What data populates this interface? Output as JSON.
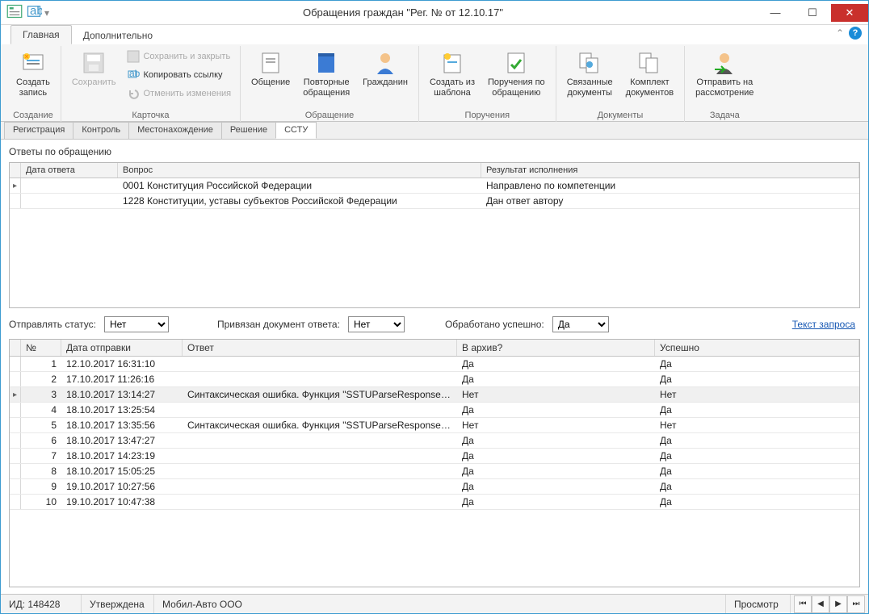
{
  "window": {
    "title": "Обращения граждан \"Рег. № от 12.10.17\""
  },
  "ribbon_tabs": {
    "main": "Главная",
    "extra": "Дополнительно"
  },
  "ribbon": {
    "create": {
      "btn": "Создать\nзапись",
      "group": "Создание"
    },
    "card": {
      "save": "Сохранить",
      "save_close": "Сохранить и закрыть",
      "copy_link": "Копировать ссылку",
      "undo": "Отменить изменения",
      "group": "Карточка"
    },
    "request": {
      "general": "Общение",
      "repeat": "Повторные\nобращения",
      "citizen": "Гражданин",
      "group": "Обращение"
    },
    "orders": {
      "from_tpl": "Создать из\nшаблона",
      "by_req": "Поручения по\nобращению",
      "group": "Поручения"
    },
    "docs": {
      "linked": "Связанные\nдокументы",
      "set": "Комплект\nдокументов",
      "group": "Документы"
    },
    "task": {
      "send": "Отправить на\nрассмотрение",
      "group": "Задача"
    }
  },
  "doc_tabs": [
    "Регистрация",
    "Контроль",
    "Местонахождение",
    "Решение",
    "ССТУ"
  ],
  "answers": {
    "title": "Ответы по обращению",
    "headers": {
      "date": "Дата ответа",
      "question": "Вопрос",
      "result": "Результат исполнения"
    },
    "rows": [
      {
        "date": "",
        "question": "0001 Конституция Российской Федерации",
        "result": "Направлено по компетенции"
      },
      {
        "date": "",
        "question": "1228 Конституции, уставы субъектов Российской Федерации",
        "result": "Дан ответ автору"
      }
    ]
  },
  "filters": {
    "send_status_label": "Отправлять статус:",
    "send_status_value": "Нет",
    "doc_bound_label": "Привязан документ ответа:",
    "doc_bound_value": "Нет",
    "processed_label": "Обработано успешно:",
    "processed_value": "Да",
    "query_link": "Текст запроса"
  },
  "log": {
    "headers": {
      "num": "№",
      "sent": "Дата отправки",
      "answer": "Ответ",
      "archive": "В архив?",
      "success": "Успешно"
    },
    "rows": [
      {
        "n": "1",
        "sent": "12.10.2017 16:31:10",
        "answer": "",
        "archive": "Да",
        "success": "Да"
      },
      {
        "n": "2",
        "sent": "17.10.2017 11:26:16",
        "answer": "",
        "archive": "Да",
        "success": "Да"
      },
      {
        "n": "3",
        "sent": "18.10.2017 13:14:27",
        "answer": "Синтаксическая ошибка. Функция \"SSTUParseResponse\": о...",
        "archive": "Нет",
        "success": "Нет"
      },
      {
        "n": "4",
        "sent": "18.10.2017 13:25:54",
        "answer": "",
        "archive": "Да",
        "success": "Да"
      },
      {
        "n": "5",
        "sent": "18.10.2017 13:35:56",
        "answer": "Синтаксическая ошибка. Функция \"SSTUParseResponse\": о...",
        "archive": "Нет",
        "success": "Нет"
      },
      {
        "n": "6",
        "sent": "18.10.2017 13:47:27",
        "answer": "",
        "archive": "Да",
        "success": "Да"
      },
      {
        "n": "7",
        "sent": "18.10.2017 14:23:19",
        "answer": "",
        "archive": "Да",
        "success": "Да"
      },
      {
        "n": "8",
        "sent": "18.10.2017 15:05:25",
        "answer": "",
        "archive": "Да",
        "success": "Да"
      },
      {
        "n": "9",
        "sent": "19.10.2017 10:27:56",
        "answer": "",
        "archive": "Да",
        "success": "Да"
      },
      {
        "n": "10",
        "sent": "19.10.2017 10:47:38",
        "answer": "",
        "archive": "Да",
        "success": "Да"
      }
    ],
    "selected_index": 2
  },
  "status": {
    "id": "ИД: 148428",
    "state": "Утверждена",
    "org": "Мобил-Авто ООО",
    "mode": "Просмотр"
  }
}
